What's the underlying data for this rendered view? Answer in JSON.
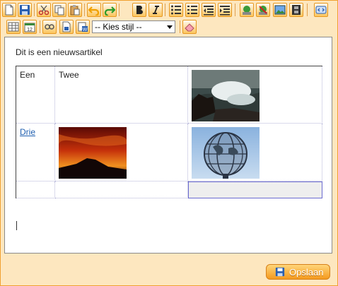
{
  "toolbar": {
    "row1": [
      "new-document",
      "save",
      "cut",
      "copy",
      "paste",
      "undo",
      "redo",
      "bold",
      "italic",
      "bullet-list",
      "numbered-list",
      "outdent",
      "indent",
      "insert-link",
      "remove-link",
      "insert-image",
      "insert-video",
      "source-code"
    ],
    "row2": [
      "insert-table",
      "insert-date",
      "spell-check",
      "document-properties",
      "word-paste",
      "eraser"
    ],
    "style_select": {
      "value": "-- Kies stijl --"
    }
  },
  "editor": {
    "intro": "Dit is een nieuwsartikel",
    "table": {
      "rows": [
        [
          {
            "text": "Een"
          },
          {
            "text": "Twee"
          },
          {
            "image": "wave-crashing-on-rocks-image"
          }
        ],
        [
          {
            "link": "Drie"
          },
          {
            "image": "volcano-sunset-image"
          },
          {
            "image": "globe-unisphere-image"
          }
        ],
        [
          {
            "text": ""
          },
          {
            "text": ""
          },
          {
            "text": "",
            "selected": true
          }
        ]
      ]
    }
  },
  "footer": {
    "save_label": "Opslaan"
  },
  "colors": {
    "frame": "#fde7bf",
    "button_orange": "#f59a1e",
    "link": "#1f5fb0"
  }
}
